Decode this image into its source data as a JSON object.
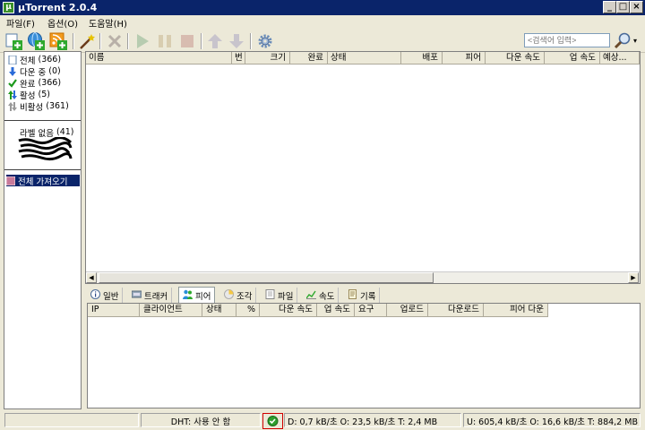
{
  "window": {
    "title": "µTorrent 2.0.4",
    "app_icon": "µ"
  },
  "window_controls": {
    "minimize": "_",
    "maximize": "□",
    "close": "×"
  },
  "menu": [
    {
      "label": "파일(F)"
    },
    {
      "label": "옵션(O)"
    },
    {
      "label": "도움말(H)"
    }
  ],
  "toolbar": {
    "search_placeholder": "<검색어 입력>",
    "search_dropdown": "▾",
    "icons": [
      "add-torrent-icon",
      "add-url-icon",
      "add-rss-icon",
      "create-torrent-icon",
      "remove-icon",
      "start-icon",
      "pause-icon",
      "stop-icon",
      "move-up-icon",
      "move-down-icon",
      "preferences-icon"
    ]
  },
  "sidebar": {
    "categories": [
      {
        "label": "전체",
        "count": "(366)"
      },
      {
        "label": "다운 중",
        "count": "(0)"
      },
      {
        "label": "완료",
        "count": "(366)"
      },
      {
        "label": "활성",
        "count": "(5)"
      },
      {
        "label": "비활성",
        "count": "(361)"
      }
    ],
    "labels": [
      {
        "label": "라벨 없음",
        "count": "(41)"
      }
    ],
    "feeds": [
      {
        "label": "전체 가져오기"
      }
    ]
  },
  "torrent_list": {
    "columns": [
      "이름",
      "번",
      "크기",
      "완료",
      "상태",
      "배포",
      "피어",
      "다운 속도",
      "업 속도",
      "예상..."
    ]
  },
  "tabs": [
    {
      "label": "일반",
      "icon": "info-icon"
    },
    {
      "label": "트래커",
      "icon": "tracker-icon"
    },
    {
      "label": "피어",
      "icon": "peers-icon",
      "active": true
    },
    {
      "label": "조각",
      "icon": "pieces-icon"
    },
    {
      "label": "파일",
      "icon": "files-icon"
    },
    {
      "label": "속도",
      "icon": "speed-icon"
    },
    {
      "label": "기록",
      "icon": "log-icon"
    }
  ],
  "peer_list": {
    "columns": [
      "IP",
      "클라이언트",
      "상태",
      "%",
      "다운 속도",
      "업 속도",
      "요구",
      "업로드",
      "다운로드",
      "피어 다운"
    ]
  },
  "statusbar": {
    "dht": "DHT: 사용 안 함",
    "download": "D: 0,7 kB/초 O: 23,5 kB/초 T: 2,4 MB",
    "upload": "U: 605,4 kB/초 O: 16,6 kB/초 T: 884,2 MB",
    "network_ok_color": "#2e9e2e"
  },
  "colors": {
    "title_bar": "#0a246a",
    "selection": "#0a246a"
  }
}
